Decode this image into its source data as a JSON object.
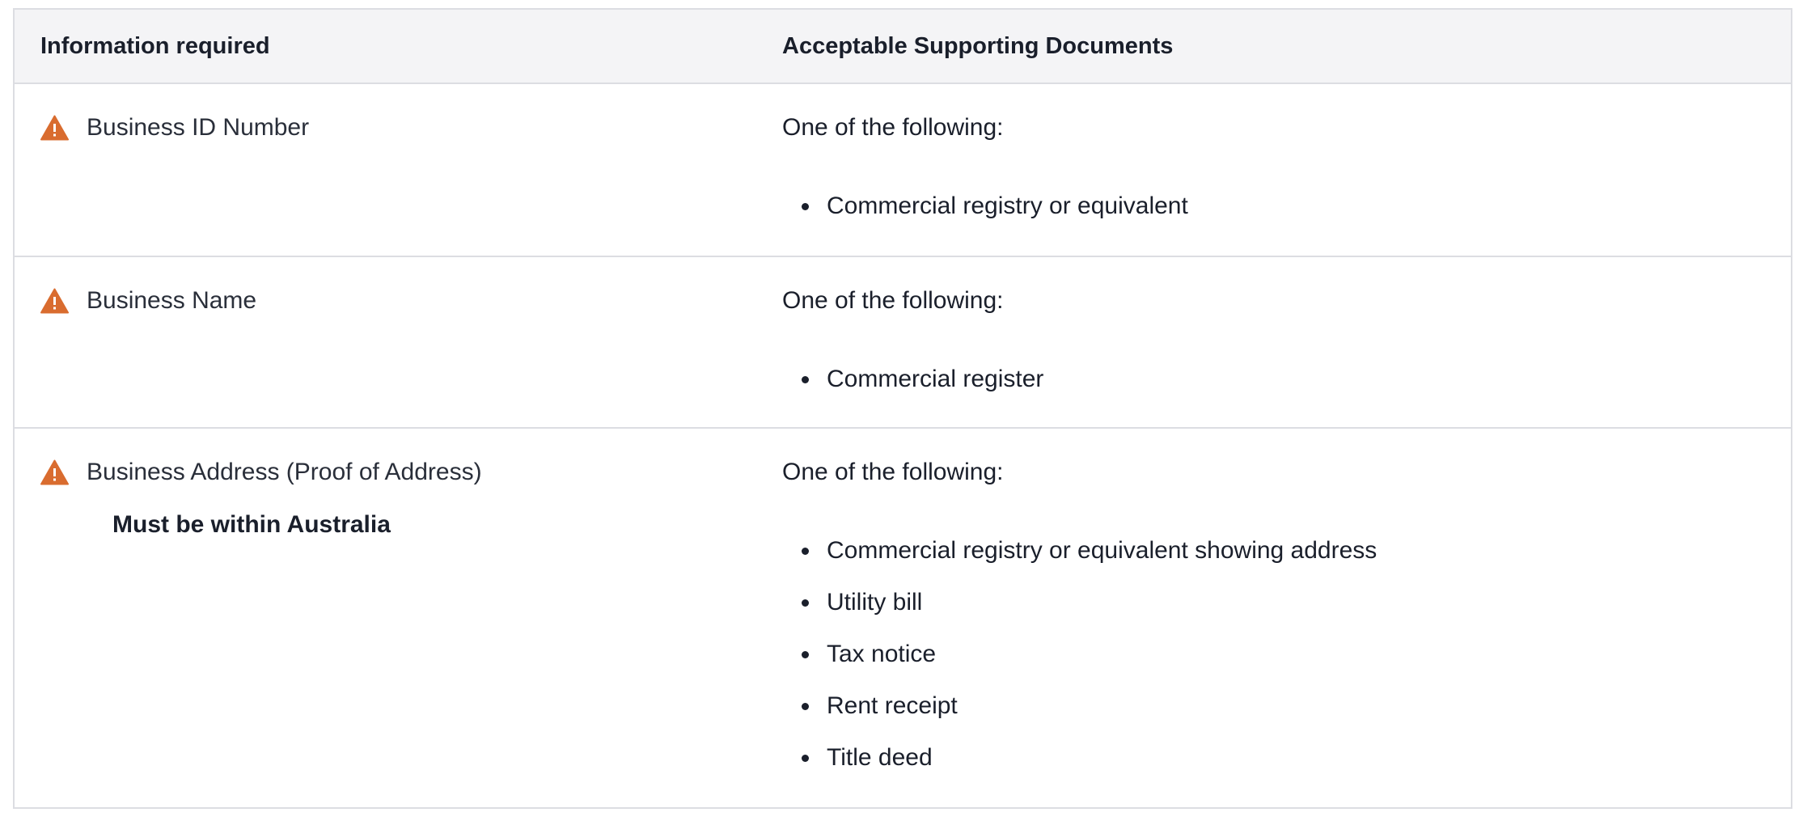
{
  "table": {
    "headers": {
      "information_required": "Information required",
      "supporting_documents": "Acceptable Supporting Documents"
    },
    "rows": [
      {
        "icon": "warning-icon",
        "label": "Business ID Number",
        "note": "",
        "intro": "One of the following:",
        "documents": [
          "Commercial registry or equivalent"
        ]
      },
      {
        "icon": "warning-icon",
        "label": "Business Name",
        "note": "",
        "intro": "One of the following:",
        "documents": [
          "Commercial register"
        ]
      },
      {
        "icon": "warning-icon",
        "label": "Business Address (Proof of Address)",
        "note": "Must be within Australia",
        "intro": "One of the following:",
        "documents": [
          "Commercial registry or equivalent showing address",
          "Utility bill",
          "Tax notice",
          "Rent receipt",
          "Title deed"
        ]
      }
    ]
  },
  "colors": {
    "warning": "#d96c2f",
    "border": "#dcdde2",
    "header_bg": "#f4f4f6",
    "text": "#1a1f2b"
  }
}
